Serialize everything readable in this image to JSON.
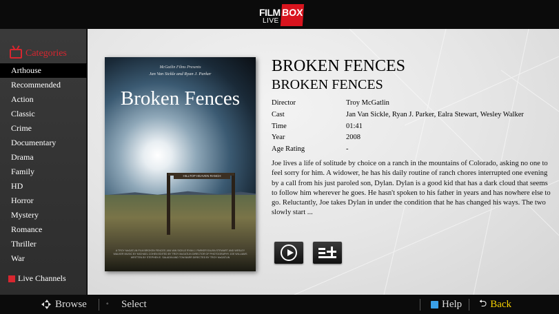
{
  "brand": {
    "film": "FILM",
    "box": "BOX",
    "live": "LIVE"
  },
  "sidebar": {
    "header": "Categories",
    "items": [
      {
        "label": "Arthouse",
        "active": true
      },
      {
        "label": "Recommended"
      },
      {
        "label": "Action"
      },
      {
        "label": "Classic"
      },
      {
        "label": "Crime"
      },
      {
        "label": "Documentary"
      },
      {
        "label": "Drama"
      },
      {
        "label": "Family"
      },
      {
        "label": "HD"
      },
      {
        "label": "Horror"
      },
      {
        "label": "Mystery"
      },
      {
        "label": "Romance"
      },
      {
        "label": "Thriller"
      },
      {
        "label": "War"
      }
    ],
    "live_channels": "Live Channels"
  },
  "poster": {
    "presents": "McGatlin Films Presents",
    "stars": "Jan Van Sickle and Ryan J. Parker",
    "title": "Broken Fences",
    "sign": "HILLTOP HEAVEN RANCH",
    "credits": "A TROY McGATLIN FILM BROKEN FENCES JAN VAN SICKLE RYAN J. PARKER EALRA STEWART AND WESLEY WALKER MUSIC BY MICHAEL COHEN EDITED BY TROY McGATLIN DIRECTOR OF PHOTOGRAPHY JOE WILLIAMS WRITTEN BY STEPHEN E. SALADIN AND TOM BARR DIRECTED BY TROY McGATLIN"
  },
  "movie": {
    "title": "BROKEN FENCES",
    "original_title": "BROKEN FENCES",
    "fields": [
      {
        "key": "Director",
        "value": "Troy McGatlin"
      },
      {
        "key": "Cast",
        "value": "Jan Van Sickle, Ryan J. Parker, Ealra Stewart, Wesley Walker"
      },
      {
        "key": "Time",
        "value": "01:41"
      },
      {
        "key": "Year",
        "value": "2008"
      },
      {
        "key": "Age Rating",
        "value": "-"
      }
    ],
    "synopsis": "Joe lives a life of solitude by choice on a ranch in the mountains of Colorado, asking no one to feel sorry for him. A widower, he has his daily routine of ranch chores interrupted one evening by a call from his just paroled son, Dylan. Dylan is a good kid that has a dark cloud that seems to follow him wherever he goes. He hasn't spoken to his father in years and has nowhere else to go. Reluctantly, Joe takes Dylan in under the condition that he has changed his ways. The two slowly start ..."
  },
  "actions": {
    "play_icon": "play-icon",
    "add_list_icon": "add-to-list-icon"
  },
  "footer": {
    "browse": "Browse",
    "select": "Select",
    "help": "Help",
    "back": "Back",
    "help_color": "#3aa0e8",
    "back_color": "#f5d000"
  },
  "colors": {
    "accent": "#d8262f",
    "brand_red": "#d8141e"
  }
}
